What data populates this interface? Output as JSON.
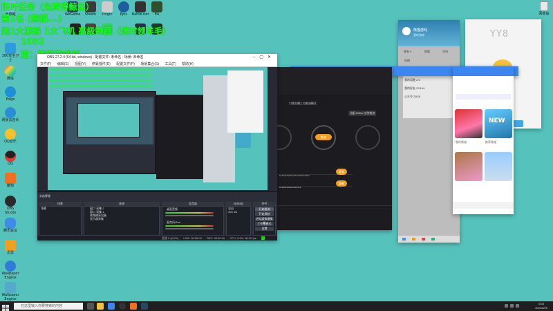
{
  "overlay": {
    "line1": "限时任务（免费得鲸鱼）",
    "line2": "第1名 (熊猫...)",
    "line3": "送1大游船 1大飞机 高级物品（随时领羊毛）",
    "line4": "1052",
    "line5": "道：熊猫游戏厅"
  },
  "desktop_icons": [
    {
      "label": "此电脑"
    },
    {
      "label": "QQ"
    },
    {
      "label": "360安全卫士"
    },
    {
      "label": "微信"
    },
    {
      "label": "网易云音乐"
    },
    {
      "label": "Edge"
    },
    {
      "label": "QQ音乐"
    },
    {
      "label": "OBS Studio"
    },
    {
      "label": "腾讯会议"
    },
    {
      "label": "酷狗"
    },
    {
      "label": "迅雷"
    },
    {
      "label": "Wallpaper Engine"
    }
  ],
  "top_icons": [
    {
      "label": "WeGame"
    },
    {
      "label": "Steam"
    },
    {
      "label": "Origin"
    },
    {
      "label": "Epic"
    },
    {
      "label": "Battle.net"
    },
    {
      "label": "EA"
    }
  ],
  "obs": {
    "title": "OBS 27.2.4 (64-bit, windows) - 配置文件: 未命名 - 场景: 未命名",
    "menu": [
      "文件(F)",
      "编辑(E)",
      "视图(V)",
      "停靠部件(D)",
      "配置文件(P)",
      "场景集合(S)",
      "工具(T)",
      "帮助(H)"
    ],
    "no_source_label": "未选择源",
    "docks": {
      "scenes": "场景",
      "sources": "来源",
      "mixer": "混音器",
      "transitions": "转场特效",
      "controls": "控件"
    },
    "scene_item": "场景",
    "sources": [
      "窗口 采集 2",
      "窗口 采集 1",
      "视频捕获设备",
      "显示器采集"
    ],
    "mixer_tracks": [
      "桌面音频",
      "麦克风/Aux"
    ],
    "transition_value": "淡出",
    "transition_duration": "300 ms",
    "control_buttons": [
      "开始推流",
      "开始录制",
      "启动虚拟摄像机",
      "工作室模式",
      "设置",
      "退出"
    ],
    "status": {
      "dropped": "丢帧 0 (0.0%)",
      "live": "LIVE: 00:00:00",
      "rec": "REC: 00:00:00",
      "cpu": "CPU: 0.9%, 30.00 fps"
    }
  },
  "darkapp": {
    "header_text": "口袋主播三方推流模式",
    "circle_labels": [
      "",
      "",
      ""
    ],
    "panel_btn": "推流",
    "field_label": "*****************",
    "input1": "•••••••••••••••••••••••••",
    "input2": "••••••••••••••••••",
    "copy_btn": "复制",
    "tooltip": "适配1080p 比例推流"
  },
  "qq": {
    "username": "熊猫游戏",
    "tabs": [
      "联系人",
      "群聊",
      "空间"
    ],
    "rows": [
      "数据区",
      "在线",
      "我的设备 2/2",
      "我的好友 97/164",
      "公众号 28/28"
    ],
    "header_tag": "我的游戏"
  },
  "yy": {
    "brand": "YY8",
    "thumb_caption_1": "我的频道",
    "thumb_caption_2": "推荐频道",
    "new_label": "NEW"
  },
  "taskbar": {
    "search_placeholder": "在这里输入你要搜索的内容",
    "time": "5:05",
    "date": "2021/8/29"
  },
  "recycle_bin": {
    "label": "回收站"
  }
}
